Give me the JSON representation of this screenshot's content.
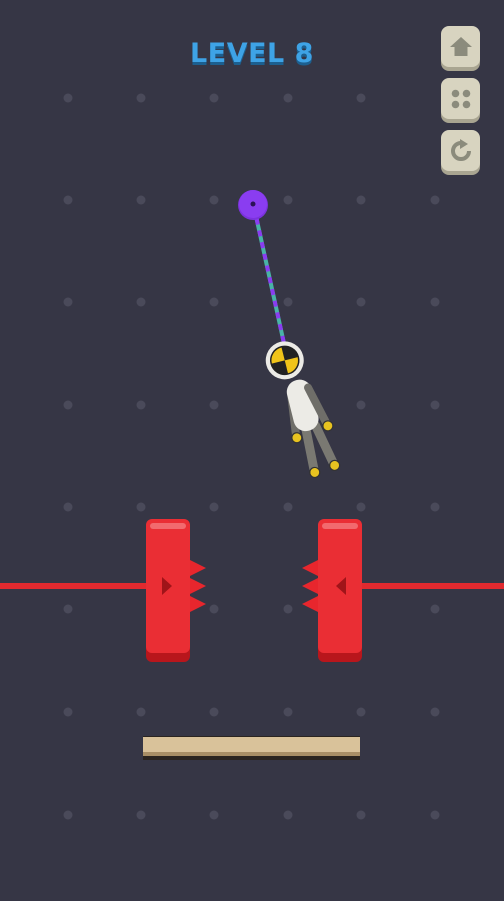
{
  "hud": {
    "level_text": "LEVEL 8"
  },
  "buttons": {
    "home_icon": "home-icon",
    "menu_icon": "grid-dots-icon",
    "restart_icon": "restart-icon"
  },
  "colors": {
    "background": "#363645",
    "grid_dot": "#4a4a5a",
    "title": "#3ea3e6",
    "button_face": "#d8d4c0",
    "button_glyph": "#8b8b7c",
    "anchor": "#8a3df0",
    "rope_a": "#8a3df0",
    "rope_b": "#49b3a6",
    "crusher": "#ea2e34",
    "laser": "#e12a2f",
    "platform": "#d9c29a"
  }
}
